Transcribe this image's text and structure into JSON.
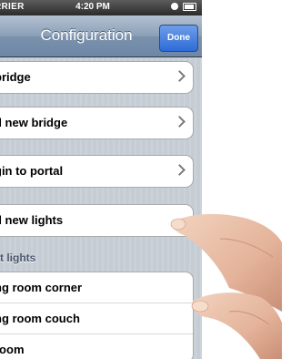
{
  "status_bar": {
    "carrier": "RRIER",
    "time": "4:20 PM"
  },
  "nav": {
    "title": "Configuration",
    "done_label": "Done"
  },
  "cells": [
    {
      "label": "bridge"
    },
    {
      "label": "d new bridge"
    },
    {
      "label": "gin to portal"
    },
    {
      "label": "d new lights"
    }
  ],
  "section": {
    "header": "t lights"
  },
  "light_rows": [
    {
      "label": "ng room corner"
    },
    {
      "label": "ng room couch"
    },
    {
      "label": "room"
    }
  ],
  "icons": [
    "signal-dot-icon",
    "battery-icon",
    "chevron-right-icon"
  ]
}
